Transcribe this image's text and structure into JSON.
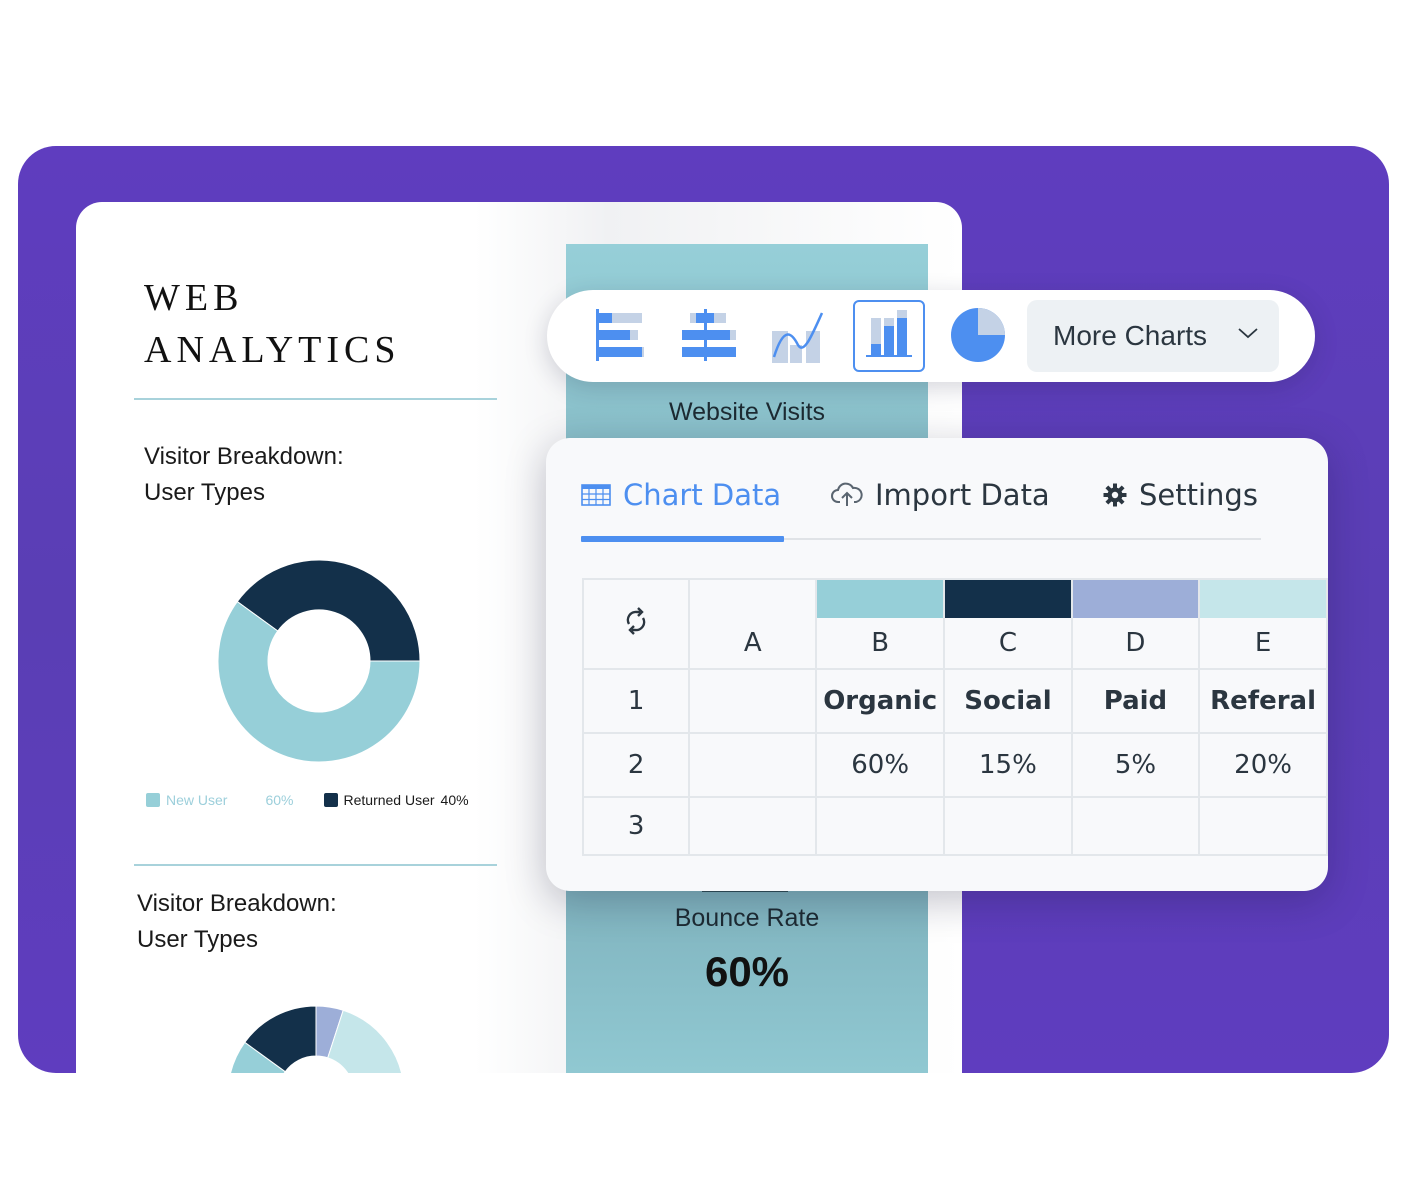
{
  "document": {
    "title_line1": "WEB",
    "title_line2": "ANALYTICS",
    "section1": {
      "heading_line1": "Visitor Breakdown:",
      "heading_line2": "User Types",
      "legend": [
        {
          "label": "New User",
          "value": "60%",
          "color": "#96cfd8"
        },
        {
          "label": "Returned User",
          "value": "40%",
          "color": "#13304a"
        }
      ]
    },
    "section2": {
      "heading_line1": "Visitor Breakdown:",
      "heading_line2": "User Types"
    },
    "stats": {
      "visits_label": "Website Visits",
      "bounce_label": "Bounce Rate",
      "bounce_value": "60%"
    }
  },
  "chart_data": [
    {
      "type": "pie",
      "title": "Visitor Breakdown: User Types",
      "donut": true,
      "categories": [
        "New User",
        "Returned User"
      ],
      "values": [
        60,
        40
      ],
      "colors": [
        "#96cfd8",
        "#13304a"
      ]
    },
    {
      "type": "pie",
      "title": "Visitor Breakdown: User Types",
      "donut": true,
      "categories": [
        "Organic",
        "Social",
        "Paid",
        "Referal"
      ],
      "values": [
        60,
        15,
        5,
        20
      ],
      "colors": [
        "#96cfd8",
        "#13304a",
        "#9daed8",
        "#c5e6ea"
      ]
    }
  ],
  "toolbar": {
    "chart_types": [
      {
        "name": "horizontal-stacked-bar",
        "active": false
      },
      {
        "name": "diverging-bar",
        "active": false
      },
      {
        "name": "line-with-bars",
        "active": false
      },
      {
        "name": "stacked-column",
        "active": true
      },
      {
        "name": "pie",
        "active": false
      }
    ],
    "more_charts_label": "More Charts",
    "accent": "#4d8ff0"
  },
  "panel": {
    "tabs": [
      {
        "label": "Chart Data",
        "icon": "table-icon",
        "active": true
      },
      {
        "label": "Import Data",
        "icon": "cloud-upload-icon",
        "active": false
      },
      {
        "label": "Settings",
        "icon": "gear-icon",
        "active": false
      }
    ],
    "table": {
      "columns": [
        {
          "letter": "A",
          "color": null
        },
        {
          "letter": "B",
          "color": "#96cfd8"
        },
        {
          "letter": "C",
          "color": "#13304a"
        },
        {
          "letter": "D",
          "color": "#9daed8"
        },
        {
          "letter": "E",
          "color": "#c5e6ea"
        }
      ],
      "rows": [
        {
          "num": "1",
          "cells": [
            "",
            "Organic",
            "Social",
            "Paid",
            "Referal"
          ]
        },
        {
          "num": "2",
          "cells": [
            "",
            "60%",
            "15%",
            "5%",
            "20%"
          ]
        },
        {
          "num": "3",
          "cells": [
            "",
            "",
            "",
            "",
            ""
          ]
        }
      ]
    }
  }
}
